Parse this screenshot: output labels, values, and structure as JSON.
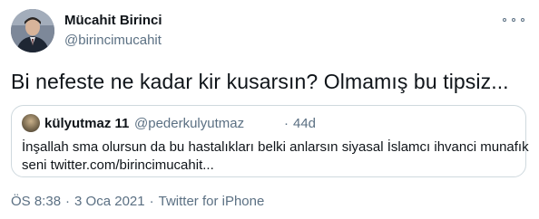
{
  "author": {
    "display_name": "Mücahit Birinci",
    "handle": "@birincimucahit"
  },
  "tweet": {
    "text": "Bi nefeste ne kadar kir kusarsın? Olmamış bu tipsiz..."
  },
  "quoted_tweet": {
    "display_name": "külyutmaz 11",
    "handle": "@pederkulyutmaz",
    "separator": "·",
    "time": "44d",
    "text_line1": "İnşallah sma olursun da bu hastalıkları belki anlarsın siyasal İslamcı ihvanci munafık",
    "text_line2": "seni twitter.com/birincimucahit..."
  },
  "meta": {
    "time": "ÖS 8:38",
    "separator1": "·",
    "date": "3 Oca 2021",
    "separator2": "·",
    "source": "Twitter for iPhone"
  },
  "icons": {
    "more": "more-horizontal-icon",
    "avatar": "profile-avatar",
    "quoted_avatar": "quoted-profile-avatar"
  },
  "colors": {
    "text_primary": "#0f1419",
    "text_secondary": "#5b7083",
    "border": "#cfd9de"
  }
}
